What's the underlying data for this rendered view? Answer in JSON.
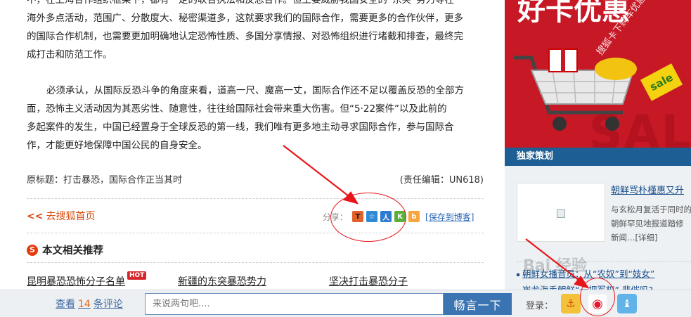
{
  "article": {
    "paragraph1": [
      "不，在上海合作组织框架下，都有一定的联合执法和反恐合作。但主要威胁我国安全的“东突”势力等在",
      "海外多点活动，范围广、分散度大、秘密渠道多，这就要求我们的国际合作，需要更多的合作伙伴，更多",
      "的国际合作机制，也需要更加明确地认定恐怖性质、多国分享情报、对恐怖组织进行堵截和排查，最终完",
      "成打击和防范工作。"
    ],
    "paragraph2": [
      "必须承认，从国际反恐斗争的角度来看，道高一尺、魔高一丈，国际合作还不足以覆盖反恐的全部方",
      "面，恐怖主义活动因为其恶劣性、随意性，往往给国际社会带来重大伤害。但“5·22案件”以及此前的",
      "多起案件的发生，中国已经置身于全球反恐的第一线，我们唯有更多地主动寻求国际合作，参与国际合",
      "作，才能更好地保障中国公民的自身安全。"
    ],
    "original_title": "原标题：打击暴恐，国际合作正当其时",
    "editor": "(责任编辑：UN618)",
    "home_link": "去搜狐首页",
    "home_arrows": "<<"
  },
  "share": {
    "label": "分享：",
    "buttons": [
      {
        "icon": "tencent-weibo-icon",
        "glyph": "T"
      },
      {
        "icon": "qzone-icon",
        "glyph": "☆"
      },
      {
        "icon": "renren-icon",
        "glyph": "人"
      },
      {
        "icon": "kaixin-icon",
        "glyph": "K"
      },
      {
        "icon": "sohu-blog-icon",
        "glyph": "b"
      }
    ],
    "save_blog": "[保存到博客]"
  },
  "related": {
    "heading": "本文相关推荐",
    "hot_badge": "HOT",
    "items": [
      "昆明暴恐恐怖分子名单",
      "新疆的东突暴恐势力",
      "坚决打击暴恐分子"
    ]
  },
  "sidebar": {
    "ad": {
      "headline": "好卡优惠",
      "diagonal_text": "搜狐卡下购车优惠",
      "sale_badge": "sale",
      "background_text": "SAL"
    },
    "exclusive": {
      "heading": "独家策划",
      "feature_title": "朝鲜骂朴槿惠又升",
      "feature_lines": [
        "与玄松月复活于同时的",
        "朝鲜罕见地报道踏修",
        "新闻…[详细]"
      ],
      "list": [
        "朝鲜女播音员：从“农奴”到“妓女”",
        "崔龙海手朝鲜“一把军权” 悲催吗?"
      ]
    }
  },
  "comment_bar": {
    "view_prefix": "查看",
    "count": "14",
    "view_suffix": "条评论",
    "input_placeholder": "来说两句吧....",
    "submit_label": "畅言一下",
    "login_label": "登录："
  },
  "watermark": "Bai 经验",
  "colors": {
    "annotation_red": "#e8161b",
    "link_orange": "#d84a0a",
    "sidebar_blue": "#1d5f94",
    "submit_blue": "#3b74b2"
  }
}
